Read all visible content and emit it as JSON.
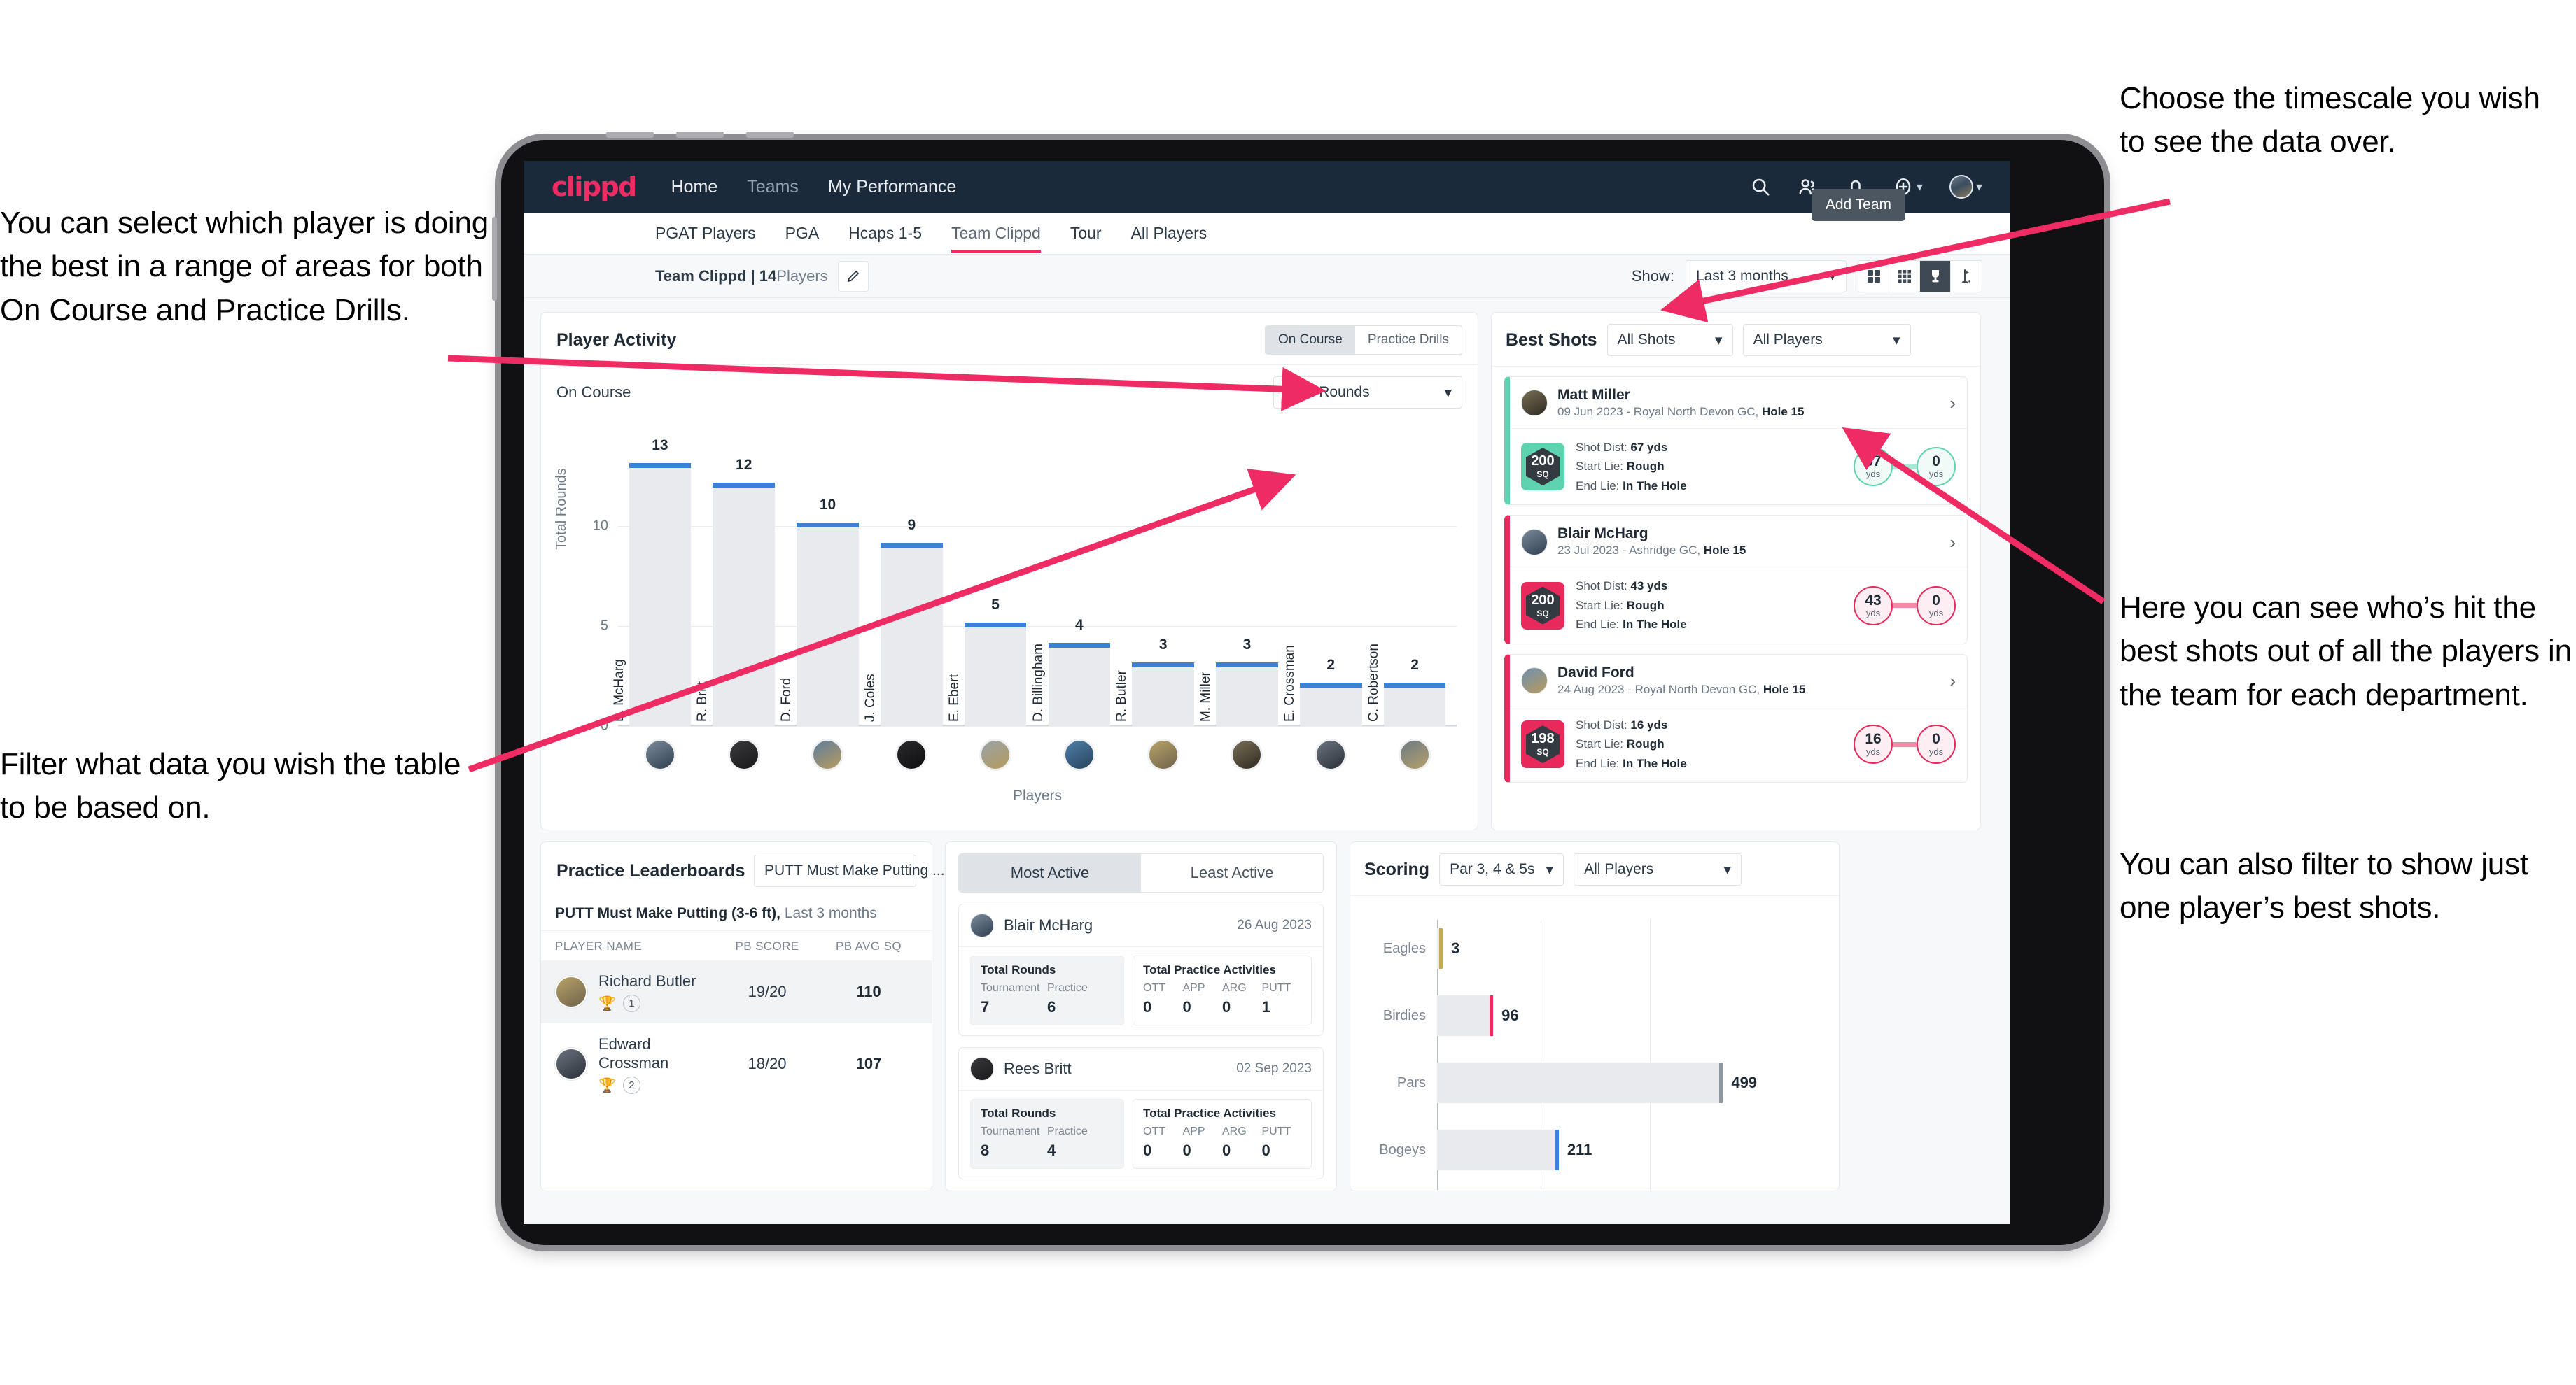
{
  "annotations": {
    "left_top": "You can select which player is doing the best in a range of areas for both On Course and Practice Drills.",
    "left_bottom": "Filter what data you wish the table to be based on.",
    "right_top": "Choose the timescale you wish to see the data over.",
    "right_middle": "Here you can see who’s hit the best shots out of all the players in the team for each department.",
    "right_bottom": "You can also filter to show just one player’s best shots."
  },
  "topnav": {
    "logo": "clippd",
    "links": [
      {
        "label": "Home",
        "active": true
      },
      {
        "label": "Teams",
        "active": false
      },
      {
        "label": "My Performance",
        "active": true
      }
    ],
    "icons": [
      "search-icon",
      "people-icon",
      "bell-icon",
      "plus-circle-icon",
      "avatar"
    ]
  },
  "subtabs": {
    "items": [
      {
        "label": "PGAT Players",
        "active": false
      },
      {
        "label": "PGA",
        "active": false
      },
      {
        "label": "Hcaps 1-5",
        "active": false
      },
      {
        "label": "Team Clippd",
        "active": true
      },
      {
        "label": "Tour",
        "active": false
      },
      {
        "label": "All Players",
        "active": false
      }
    ],
    "tooltip": "Add Team"
  },
  "toolbar": {
    "team_name": "Team Clippd",
    "separator": "|",
    "player_count": "14",
    "players_word": "Players",
    "show_label": "Show:",
    "timescale_value": "Last 3 months",
    "view_icons": [
      "grid-large-icon",
      "grid-small-icon",
      "trophy-icon",
      "flag-icon"
    ],
    "selected_view": "trophy-icon"
  },
  "player_activity": {
    "title": "Player Activity",
    "toggle": [
      {
        "label": "On Course",
        "selected": true
      },
      {
        "label": "Practice Drills",
        "selected": false
      }
    ],
    "sub_label": "On Course",
    "metric_select": "Total Rounds"
  },
  "chart_data": {
    "type": "bar",
    "title": "Player Activity – On Course",
    "xlabel": "Players",
    "ylabel": "Total Rounds",
    "ylim": [
      0,
      14
    ],
    "yticks": [
      0,
      5,
      10
    ],
    "grid": true,
    "categories": [
      "B. McHarg",
      "R. Britt",
      "D. Ford",
      "J. Coles",
      "E. Ebert",
      "D. Billingham",
      "R. Butler",
      "M. Miller",
      "E. Crossman",
      "C. Robertson"
    ],
    "values": [
      13,
      12,
      10,
      9,
      5,
      4,
      3,
      3,
      2,
      2
    ],
    "bar_color": "#e8eaed",
    "cap_color": "#3b82d6"
  },
  "best_shots": {
    "title": "Best Shots",
    "shots_filter": "All Shots",
    "players_filter": "All Players",
    "cards": [
      {
        "name": "Matt Miller",
        "meta_date": "09 Jun 2023 - Royal North Devon GC,",
        "meta_hole": "Hole 15",
        "badge_value": "200",
        "badge_unit": "SQ",
        "accent": "#5fd3b0",
        "shot_dist_label": "Shot Dist:",
        "shot_dist_value": "67 yds",
        "start_lie_label": "Start Lie:",
        "start_lie_value": "Rough",
        "end_lie_label": "End Lie:",
        "end_lie_value": "In The Hole",
        "start_num": "67",
        "start_unit": "yds",
        "end_num": "0",
        "end_unit": "yds"
      },
      {
        "name": "Blair McHarg",
        "meta_date": "23 Jul 2023 - Ashridge GC,",
        "meta_hole": "Hole 15",
        "badge_value": "200",
        "badge_unit": "SQ",
        "accent": "#e8295c",
        "shot_dist_label": "Shot Dist:",
        "shot_dist_value": "43 yds",
        "start_lie_label": "Start Lie:",
        "start_lie_value": "Rough",
        "end_lie_label": "End Lie:",
        "end_lie_value": "In The Hole",
        "start_num": "43",
        "start_unit": "yds",
        "end_num": "0",
        "end_unit": "yds"
      },
      {
        "name": "David Ford",
        "meta_date": "24 Aug 2023 - Royal North Devon GC,",
        "meta_hole": "Hole 15",
        "badge_value": "198",
        "badge_unit": "SQ",
        "accent": "#e8295c",
        "shot_dist_label": "Shot Dist:",
        "shot_dist_value": "16 yds",
        "start_lie_label": "Start Lie:",
        "start_lie_value": "Rough",
        "end_lie_label": "End Lie:",
        "end_lie_value": "In The Hole",
        "start_num": "16",
        "start_unit": "yds",
        "end_num": "0",
        "end_unit": "yds"
      }
    ]
  },
  "practice_leaderboards": {
    "title": "Practice Leaderboards",
    "drill_select": "PUTT Must Make Putting ...",
    "sub_title": "PUTT Must Make Putting (3-6 ft),",
    "sub_period": "Last 3 months",
    "columns": [
      "PLAYER NAME",
      "PB SCORE",
      "PB AVG SQ"
    ],
    "rows": [
      {
        "name": "Richard Butler",
        "trophy": "gold",
        "rank": "1",
        "pb_score": "19/20",
        "pb_avg_sq": "110"
      },
      {
        "name": "Edward Crossman",
        "trophy": "silver",
        "rank": "2",
        "pb_score": "18/20",
        "pb_avg_sq": "107"
      }
    ]
  },
  "activity": {
    "tabs": [
      {
        "label": "Most Active",
        "selected": true
      },
      {
        "label": "Least Active",
        "selected": false
      }
    ],
    "rounds_title": "Total Rounds",
    "practice_title": "Total Practice Activities",
    "rounds_keys": [
      "Tournament",
      "Practice"
    ],
    "practice_keys": [
      "OTT",
      "APP",
      "ARG",
      "PUTT"
    ],
    "cards": [
      {
        "name": "Blair McHarg",
        "date": "26 Aug 2023",
        "rounds": [
          "7",
          "6"
        ],
        "practice": [
          "0",
          "0",
          "0",
          "1"
        ]
      },
      {
        "name": "Rees Britt",
        "date": "02 Sep 2023",
        "rounds": [
          "8",
          "4"
        ],
        "practice": [
          "0",
          "0",
          "0",
          "0"
        ]
      }
    ]
  },
  "scoring": {
    "title": "Scoring",
    "par_filter": "Par 3, 4 & 5s",
    "players_filter": "All Players"
  },
  "scoring_chart": {
    "type": "bar",
    "orientation": "horizontal",
    "title": "Scoring",
    "categories": [
      "Eagles",
      "Birdies",
      "Pars",
      "Bogeys"
    ],
    "values": [
      3,
      96,
      499,
      211
    ],
    "colors": [
      "#c3a75a",
      "#e8295c",
      "#8e969e",
      "#3b82d6"
    ],
    "xlim": [
      0,
      560
    ],
    "gridlines": [
      0,
      186,
      373
    ],
    "bar_color": "#e8eaed"
  }
}
